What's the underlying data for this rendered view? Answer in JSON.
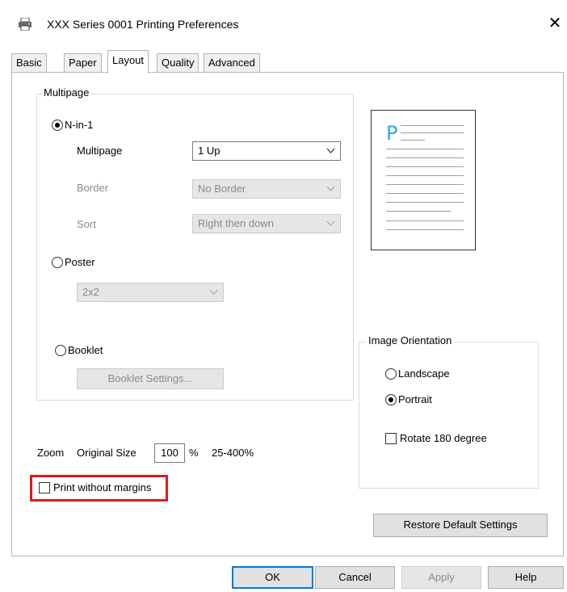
{
  "window": {
    "title": "XXX  Series 0001 Printing Preferences",
    "title_icon": "printer-icon",
    "close_icon": "close-icon",
    "close_glyph": "✕"
  },
  "tabs": [
    {
      "label": "Basic"
    },
    {
      "label": "Paper"
    },
    {
      "label": "Layout"
    },
    {
      "label": "Quality"
    },
    {
      "label": "Advanced"
    }
  ],
  "active_tab": "Layout",
  "multipage": {
    "group_label": "Multipage",
    "nin1": {
      "label": "N-in-1",
      "selected": true,
      "multipage_label": "Multipage",
      "multipage_value": "1 Up",
      "border_label": "Border",
      "border_value": "No Border",
      "sort_label": "Sort",
      "sort_value": "Right then down"
    },
    "poster": {
      "label": "Poster",
      "selected": false,
      "value": "2x2"
    },
    "booklet": {
      "label": "Booklet",
      "selected": false,
      "settings_button": "Booklet Settings..."
    }
  },
  "preview": {
    "letter": "P"
  },
  "orientation": {
    "group_label": "Image Orientation",
    "landscape_label": "Landscape",
    "portrait_label": "Portrait",
    "selected": "Portrait",
    "rotate_label": "Rotate 180 degree",
    "rotate_checked": false
  },
  "zoom": {
    "label": "Zoom",
    "mode": "Original Size",
    "value": "100",
    "unit": "%",
    "range": "25-400%"
  },
  "print_without_margins": {
    "label": "Print without margins",
    "checked": false,
    "highlight_color": "#e0191f"
  },
  "restore_button": "Restore Default Settings",
  "footer": {
    "ok": "OK",
    "cancel": "Cancel",
    "apply": "Apply",
    "help": "Help"
  },
  "colors": {
    "accent": "#0078d7",
    "preview_letter": "#2aa8e8"
  }
}
